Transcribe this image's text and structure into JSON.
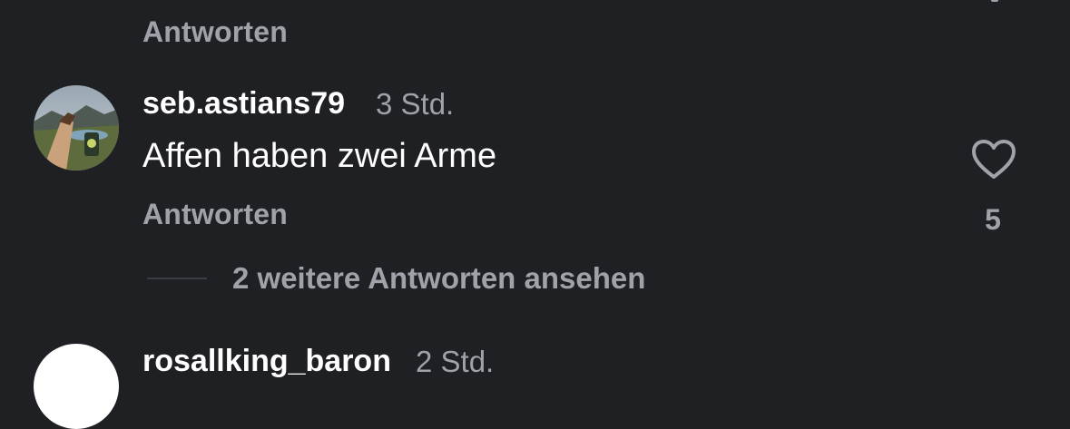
{
  "previous_comment": {
    "reply_label": "Antworten"
  },
  "comment": {
    "username": "seb.astians79",
    "timestamp": "3 Std.",
    "text": "Affen haben zwei Arme",
    "reply_label": "Antworten",
    "like_count": "5",
    "like_icon": "heart-outline-icon"
  },
  "more_replies": {
    "label": "2 weitere Antworten ansehen"
  },
  "next_comment": {
    "username": "rosallking_baron",
    "timestamp": "2 Std."
  },
  "colors": {
    "background": "#1f2024",
    "primary_text": "#ffffff",
    "secondary_text": "#a0a2a9"
  }
}
